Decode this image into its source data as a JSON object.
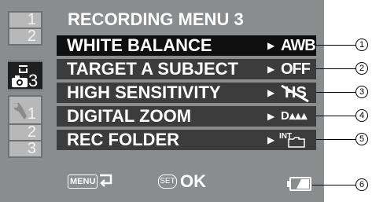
{
  "title": "RECORDING MENU 3",
  "tabs": {
    "recording": [
      "1",
      "2"
    ],
    "active_label": "3",
    "setup": [
      "1",
      "2",
      "3"
    ]
  },
  "menu": [
    {
      "label": "WHITE BALANCE",
      "value": "AWB",
      "selected": true
    },
    {
      "label": "TARGET A SUBJECT",
      "value": "OFF",
      "selected": false
    },
    {
      "label": "HIGH SENSITIVITY",
      "value": "HS",
      "selected": false
    },
    {
      "label": "DIGITAL ZOOM",
      "value": "D▴▴▴",
      "selected": false
    },
    {
      "label": "REC FOLDER",
      "value": "INT",
      "selected": false
    }
  ],
  "footer": {
    "menu_key": "MENU",
    "set_key": "SET",
    "ok": "OK"
  },
  "callouts": [
    "1",
    "2",
    "3",
    "4",
    "5",
    "6"
  ],
  "colors": {
    "screen_bg": "#8a8c8d",
    "row_bg": "#3c3c3c",
    "selected_row_bg": "#0f0f0f",
    "tab_bg": "#b8b8b8",
    "text": "#ffffff"
  }
}
